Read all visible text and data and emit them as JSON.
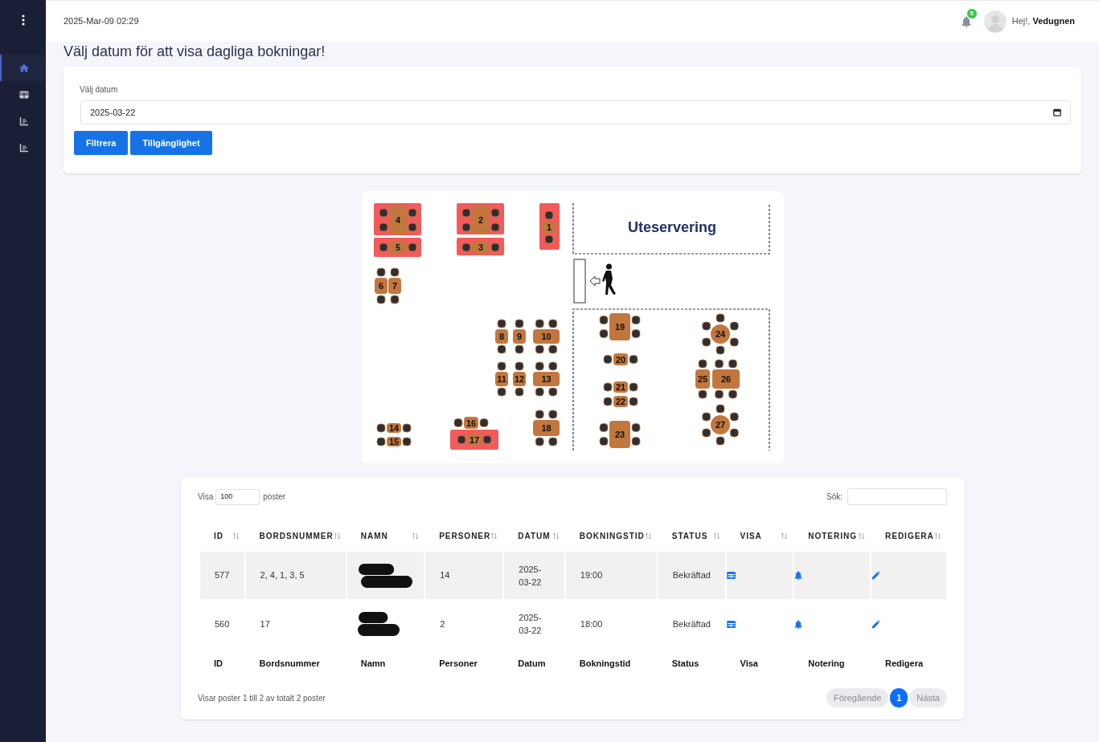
{
  "sidebar": {
    "items": [
      {
        "selected": true
      },
      {
        "selected": false
      },
      {
        "selected": false
      },
      {
        "selected": false
      }
    ]
  },
  "topbar": {
    "datetime": "2025-Mar-09 02:29",
    "notification_count": "5",
    "greeting": "Hej!, **Vedugnen**"
  },
  "heading": "Välj datum för att visa dagliga bokningar!",
  "filter": {
    "label": "Välj datum",
    "date_value": "2025-03-22",
    "buttons": [
      "Filtrera",
      "Tillgänglighet"
    ]
  },
  "floor_plan": {
    "area_label": "Uteservering",
    "tables": [
      {
        "number": "1",
        "booked": true
      },
      {
        "number": "2",
        "booked": true
      },
      {
        "number": "3",
        "booked": true
      },
      {
        "number": "4",
        "booked": true
      },
      {
        "number": "5",
        "booked": true
      },
      {
        "number": "6",
        "booked": false
      },
      {
        "number": "7",
        "booked": false
      },
      {
        "number": "8",
        "booked": false
      },
      {
        "number": "9",
        "booked": false
      },
      {
        "number": "10",
        "booked": false
      },
      {
        "number": "11",
        "booked": false
      },
      {
        "number": "12",
        "booked": false
      },
      {
        "number": "13",
        "booked": false
      },
      {
        "number": "14",
        "booked": false
      },
      {
        "number": "15",
        "booked": false
      },
      {
        "number": "16",
        "booked": false
      },
      {
        "number": "17",
        "booked": true
      },
      {
        "number": "18",
        "booked": false
      },
      {
        "number": "19",
        "booked": false
      },
      {
        "number": "20",
        "booked": false
      },
      {
        "number": "21",
        "booked": false
      },
      {
        "number": "22",
        "booked": false
      },
      {
        "number": "23",
        "booked": false
      },
      {
        "number": "24",
        "booked": false
      },
      {
        "number": "25",
        "booked": false
      },
      {
        "number": "26",
        "booked": false
      },
      {
        "number": "27",
        "booked": false
      }
    ]
  },
  "bookings": {
    "length_before": "Visa",
    "page_length": "100",
    "length_after": "poster",
    "search_label": "Sök:",
    "columns": [
      "ID",
      "BORDSNUMMER",
      "NAMN",
      "PERSONER",
      "DATUM",
      "BOKNINGSTID",
      "STATUS",
      "VISA",
      "NOTERING",
      "REDIGERA"
    ],
    "rows": [
      {
        "id": "577",
        "tables": "2, 4, 1, 3, 5",
        "name_redacted": true,
        "persons": "14",
        "date": "2025-03-22",
        "time": "19:00",
        "status": "Bekräftad",
        "shaded": true
      },
      {
        "id": "560",
        "tables": "17",
        "name_redacted": true,
        "persons": "2",
        "date": "2025-03-22",
        "time": "18:00",
        "status": "Bekräftad",
        "shaded": false
      }
    ],
    "footer_columns": [
      "ID",
      "Bordsnummer",
      "Namn",
      "Personer",
      "Datum",
      "Bokningstid",
      "Status",
      "Visa",
      "Notering",
      "Redigera"
    ],
    "info": "Visar poster 1 till 2 av totalt 2 poster",
    "pagination": {
      "previous": "Föregående",
      "pages": [
        {
          "label": "1",
          "selected": true
        }
      ],
      "next": "Nästa"
    }
  }
}
